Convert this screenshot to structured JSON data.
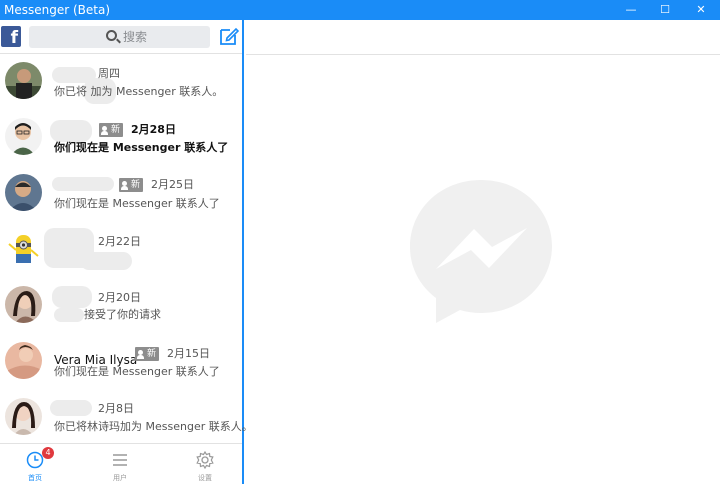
{
  "window": {
    "title": "Messenger (Beta)",
    "controls": {
      "minimize": "—",
      "maximize": "☐",
      "close": "✕"
    }
  },
  "sidebar": {
    "search_placeholder": "搜索",
    "conversations": [
      {
        "name": "",
        "new_label": "",
        "date": "周四",
        "preview": "你已将         加为 Messenger 联系人。",
        "unread": false
      },
      {
        "name": "",
        "new_label": "新",
        "date": "2月28日",
        "preview": "你们现在是 Messenger 联系人了",
        "unread": true
      },
      {
        "name": "",
        "new_label": "新",
        "date": "2月25日",
        "preview": "你们现在是 Messenger 联系人了",
        "unread": false
      },
      {
        "name": "",
        "new_label": "",
        "date": "2月22日",
        "preview": "",
        "unread": false
      },
      {
        "name": "",
        "new_label": "",
        "date": "2月20日",
        "preview": "接受了你的请求",
        "unread": false
      },
      {
        "name": "Vera Mia Ilysa",
        "new_label": "新",
        "date": "2月15日",
        "preview": "你们现在是 Messenger 联系人了",
        "unread": false
      },
      {
        "name": "",
        "new_label": "",
        "date": "2月8日",
        "preview": "你已将林诗玛加为 Messenger 联系人。",
        "unread": false
      }
    ]
  },
  "bottom_nav": {
    "home_label": "首页",
    "home_badge": "4",
    "people_label": "用户",
    "settings_label": "设置"
  },
  "colors": {
    "accent": "#1a8cf7",
    "facebook": "#3b5998",
    "badge": "#e0393e"
  }
}
